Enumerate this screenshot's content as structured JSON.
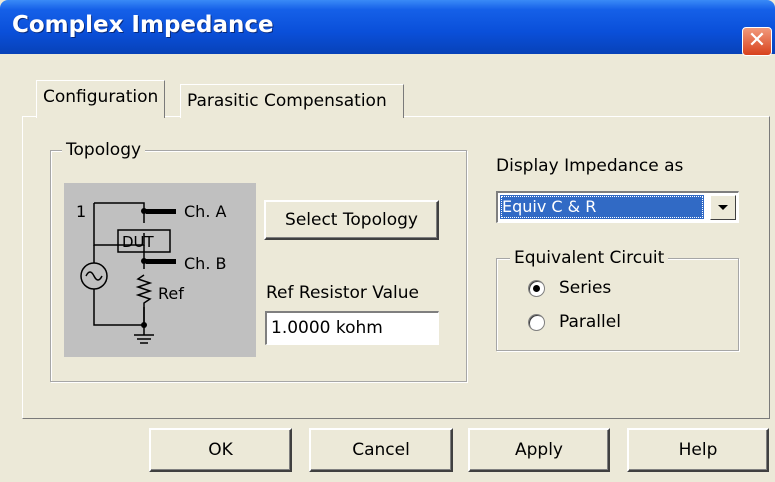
{
  "window": {
    "title": "Complex Impedance",
    "close_glyph": "✕"
  },
  "tabs": [
    {
      "label": "Configuration",
      "active": true
    },
    {
      "label": "Parasitic Compensation",
      "active": false
    }
  ],
  "topology": {
    "group_label": "Topology",
    "diagram": {
      "node_label": "1",
      "ch_a_label": "Ch. A",
      "dut_label": "DUT",
      "ch_b_label": "Ch. B",
      "ref_label": "Ref"
    },
    "select_button": "Select Topology",
    "ref_resistor_label": "Ref Resistor Value",
    "ref_resistor_value": "1.0000 kohm"
  },
  "display": {
    "label": "Display Impedance as",
    "selected": "Equiv C & R"
  },
  "equivalent_circuit": {
    "group_label": "Equivalent Circuit",
    "options": [
      {
        "label": "Series",
        "checked": true
      },
      {
        "label": "Parallel",
        "checked": false
      }
    ]
  },
  "footer": {
    "ok": "OK",
    "cancel": "Cancel",
    "apply": "Apply",
    "help": "Help"
  },
  "colors": {
    "titlebar": "#0a4fd9",
    "selection": "#316ac5",
    "close": "#d8411c",
    "diagram_bg": "#c0c0c0"
  }
}
